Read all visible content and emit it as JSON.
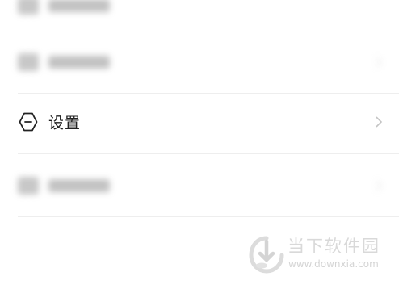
{
  "settings_list": {
    "items": [
      {
        "label": "",
        "icon": "blurred-icon",
        "blurred": true
      },
      {
        "label": "",
        "icon": "blurred-icon",
        "blurred": true
      },
      {
        "label": "设置",
        "icon": "hexagon-minus-icon",
        "blurred": false
      },
      {
        "label": "",
        "icon": "blurred-icon",
        "blurred": true
      }
    ]
  },
  "watermark": {
    "title": "当下软件园",
    "url": "www.downxia.com"
  },
  "colors": {
    "text": "#222222",
    "chevron": "#c8c8c8",
    "watermark": "#d9d9d9"
  }
}
